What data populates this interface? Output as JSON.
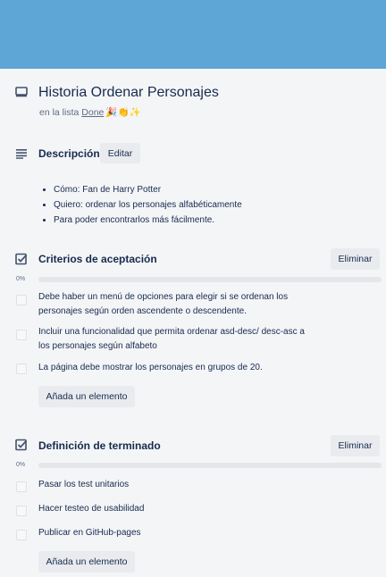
{
  "card": {
    "title": "Historia Ordenar Personajes",
    "list_prefix": "en la lista",
    "list_name": "Done",
    "list_emoji": "🎉👏✨"
  },
  "description": {
    "heading": "Descripción",
    "edit_label": "Editar",
    "bullets": [
      "Cómo: Fan de Harry Potter",
      "Quiero: ordenar los personajes alfabéticamente",
      "Para poder encontrarlos más fácilmente."
    ]
  },
  "checklists": [
    {
      "title": "Criterios de aceptación",
      "delete_label": "Eliminar",
      "progress_text": "0%",
      "progress_value": 0,
      "items": [
        "Debe haber un menú de opciones para elegir si se ordenan los personajes según orden ascendente o descendente.",
        "Incluir una funcionalidad que permita ordenar asd-desc/ desc-asc a los personajes según alfabeto",
        "La página debe mostrar los personajes en grupos de 20."
      ],
      "add_label": "Añada un elemento"
    },
    {
      "title": "Definición de terminado",
      "delete_label": "Eliminar",
      "progress_text": "0%",
      "progress_value": 0,
      "items": [
        "Pasar los test unitarios",
        "Hacer testeo de usabilidad",
        "Publicar en GitHub-pages"
      ],
      "add_label": "Añada un elemento"
    }
  ]
}
